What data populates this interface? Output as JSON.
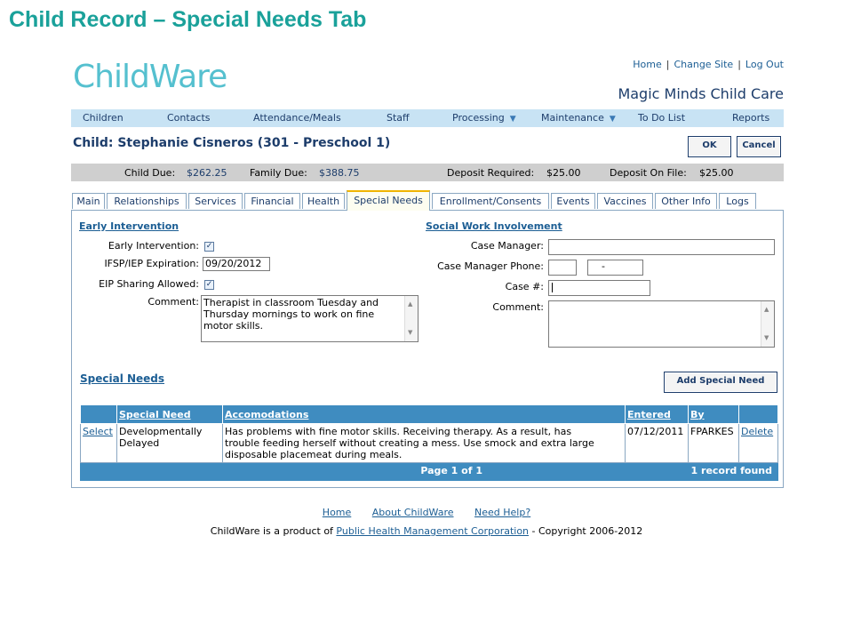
{
  "slide_title": "Child Record – Special Needs Tab",
  "app": {
    "logo_a": "Child",
    "logo_b": "Ware",
    "toplinks": [
      "Home",
      "Change Site",
      "Log Out"
    ],
    "site_name": "Magic Minds Child Care"
  },
  "menu": [
    {
      "label": "Children",
      "dropdown": false
    },
    {
      "label": "Contacts",
      "dropdown": false
    },
    {
      "label": "Attendance/Meals",
      "dropdown": false
    },
    {
      "label": "Staff",
      "dropdown": false
    },
    {
      "label": "Processing",
      "dropdown": true
    },
    {
      "label": "Maintenance",
      "dropdown": true
    },
    {
      "label": "To Do List",
      "dropdown": false
    },
    {
      "label": "Reports",
      "dropdown": false
    }
  ],
  "child": {
    "header": "Child: Stephanie Cisneros (301 - Preschool 1)",
    "ok_label": "OK",
    "cancel_label": "Cancel"
  },
  "dues": {
    "child_due_label": "Child Due:",
    "child_due": "$262.25",
    "family_due_label": "Family Due:",
    "family_due": "$388.75",
    "deposit_required_label": "Deposit Required:",
    "deposit_required": "$25.00",
    "deposit_on_file_label": "Deposit On File:",
    "deposit_on_file": "$25.00"
  },
  "tabs": [
    "Main",
    "Relationships",
    "Services",
    "Financial",
    "Health",
    "Special Needs",
    "Enrollment/Consents",
    "Events",
    "Vaccines",
    "Other Info",
    "Logs"
  ],
  "active_tab": "Special Needs",
  "early_intervention": {
    "title": "Early Intervention",
    "ei_label": "Early Intervention:",
    "ei_checked": true,
    "ifsp_label": "IFSP/IEP Expiration:",
    "ifsp_value": "09/20/2012",
    "eip_label": "EIP Sharing Allowed:",
    "eip_checked": true,
    "comment_label": "Comment:",
    "comment_line1": "Therapist in classroom Tuesday and",
    "comment_line2": "Thursday mornings to work on fine",
    "comment_line3": "motor skills."
  },
  "social_work": {
    "title": "Social Work Involvement",
    "case_manager_label": "Case Manager:",
    "case_manager_value": "",
    "phone_label": "Case Manager Phone:",
    "phone_area": "",
    "phone_number": "-",
    "case_num_label": "Case #:",
    "case_num_value": "",
    "comment_label": "Comment:",
    "comment_value": ""
  },
  "special_needs": {
    "title": "Special Needs",
    "add_button": "Add Special Need",
    "columns": [
      "",
      "Special Need",
      "Accomodations",
      "Entered",
      "By",
      ""
    ],
    "rows": [
      {
        "select": "Select",
        "need_line1": "Developmentally",
        "need_line2": "Delayed",
        "accom_line1": "Has problems with fine motor skills. Receiving therapy. As a result, has",
        "accom_line2": "trouble feeding herself without creating a mess. Use smock and extra large",
        "accom_line3": "disposable placemeat during meals.",
        "entered": "07/12/2011",
        "by": "FPARKES",
        "delete": "Delete"
      }
    ],
    "page_info": "Page 1 of 1",
    "record_count": "1 record found"
  },
  "footer": {
    "links": [
      "Home",
      "About ChildWare",
      "Need Help?"
    ],
    "copy_prefix": "ChildWare is a product of ",
    "copy_link": "Public Health Management Corporation",
    "copy_suffix": " - Copyright 2006-2012"
  }
}
